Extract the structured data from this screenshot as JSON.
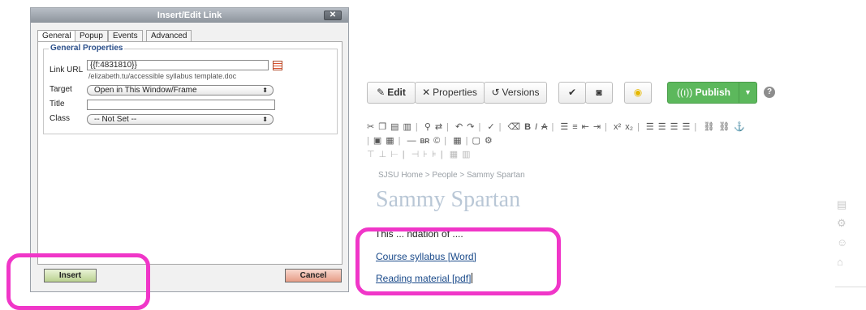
{
  "dialog": {
    "title": "Insert/Edit Link",
    "close": "✕",
    "tabs": [
      "General",
      "Popup",
      "Events",
      "Advanced"
    ],
    "fieldset_legend": "General Properties",
    "link_url_label": "Link URL",
    "link_url_value": "{{f:4831810}}",
    "link_url_subtext": "/elizabeth.tu/accessible syllabus template.doc",
    "target_label": "Target",
    "target_value": "Open in This Window/Frame",
    "title_label": "Title",
    "title_value": "",
    "class_label": "Class",
    "class_value": "-- Not Set --",
    "insert_label": "Insert",
    "cancel_label": "Cancel"
  },
  "toolbar": {
    "edit_label": "Edit",
    "properties_label": "Properties",
    "versions_label": "Versions",
    "publish_label": "Publish"
  },
  "editor": {
    "breadcrumb": "SJSU Home > People > Sammy Spartan",
    "page_title": "Sammy Spartan",
    "body_text": "This ... ndation of ....",
    "links": [
      "Course syllabus [Word]",
      "Reading material [pdf]"
    ]
  },
  "colors": {
    "highlight": "#f036c8",
    "publish": "#5cb85c",
    "link": "#1a4a8a"
  }
}
